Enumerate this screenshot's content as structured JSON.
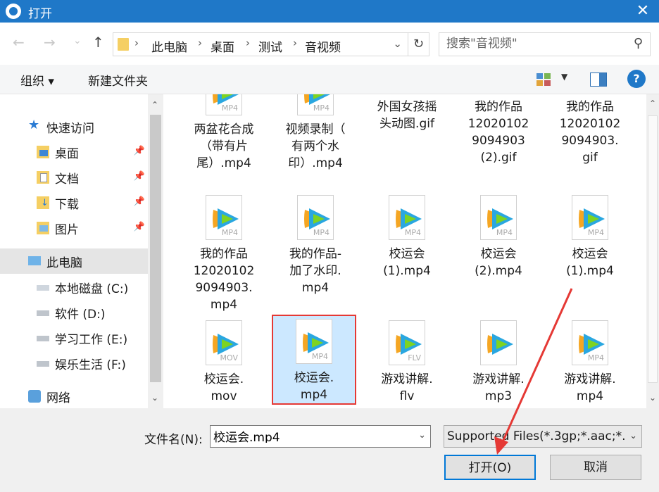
{
  "window": {
    "title": "打开",
    "close_glyph": "✕"
  },
  "nav": {
    "back": "←",
    "forward": "→",
    "history": "⌄",
    "up": "↑",
    "breadcrumbs": [
      "此电脑",
      "桌面",
      "测试",
      "音视频"
    ],
    "refresh_glyph": "↻"
  },
  "search": {
    "placeholder": "搜索\"音视频\""
  },
  "toolbar": {
    "organize": "组织 ▾",
    "new_folder": "新建文件夹",
    "help": "?"
  },
  "sidebar": {
    "quick_access": "快速访问",
    "items": [
      {
        "label": "桌面",
        "icon": "desktop-folder-icon"
      },
      {
        "label": "文档",
        "icon": "documents-folder-icon"
      },
      {
        "label": "下载",
        "icon": "downloads-folder-icon"
      },
      {
        "label": "图片",
        "icon": "pictures-folder-icon"
      }
    ],
    "this_pc": "此电脑",
    "drives": [
      {
        "label": "本地磁盘 (C:)"
      },
      {
        "label": "软件 (D:)"
      },
      {
        "label": "学习工作 (E:)"
      },
      {
        "label": "娱乐生活 (F:)"
      }
    ],
    "network": "网络"
  },
  "files": {
    "row1": [
      {
        "lines": [
          "两盆花合成",
          "（带有片",
          "尾）.mp4"
        ],
        "ext": "MP4",
        "kind": "video"
      },
      {
        "lines": [
          "视频录制（",
          "有两个水",
          "印）.mp4"
        ],
        "ext": "MP4",
        "kind": "video"
      },
      {
        "lines": [
          "外国女孩摇",
          "头动图.gif"
        ],
        "ext": "",
        "kind": "gif"
      },
      {
        "lines": [
          "我的作品",
          "12020102",
          "9094903",
          "(2).gif"
        ],
        "ext": "",
        "kind": "photo"
      },
      {
        "lines": [
          "我的作品",
          "12020102",
          "9094903.",
          "gif"
        ],
        "ext": "",
        "kind": "photo"
      }
    ],
    "row2": [
      {
        "lines": [
          "我的作品",
          "12020102",
          "9094903.",
          "mp4"
        ],
        "ext": "MP4",
        "kind": "video"
      },
      {
        "lines": [
          "我的作品-",
          "加了水印.",
          "mp4"
        ],
        "ext": "MP4",
        "kind": "video"
      },
      {
        "lines": [
          "校运会",
          "(1).mp4"
        ],
        "ext": "MP4",
        "kind": "video"
      },
      {
        "lines": [
          "校运会",
          "(2).mp4"
        ],
        "ext": "MP4",
        "kind": "video"
      },
      {
        "lines": [
          "校运会",
          "(1).mp4"
        ],
        "ext": "MP4",
        "kind": "video"
      }
    ],
    "row3": [
      {
        "lines": [
          "校运会.",
          "mov"
        ],
        "ext": "MOV",
        "kind": "video"
      },
      {
        "lines": [
          "校运会.",
          "mp4"
        ],
        "ext": "MP4",
        "kind": "video",
        "selected": true
      },
      {
        "lines": [
          "游戏讲解.",
          "flv"
        ],
        "ext": "FLV",
        "kind": "video"
      },
      {
        "lines": [
          "游戏讲解.",
          "mp3"
        ],
        "ext": "",
        "kind": "video"
      },
      {
        "lines": [
          "游戏讲解.",
          "mp4"
        ],
        "ext": "MP4",
        "kind": "video"
      }
    ]
  },
  "footer": {
    "filename_label": "文件名(N):",
    "filename_value": "校运会.mp4",
    "filetype_value": "Supported Files(*.3gp;*.aac;*.",
    "open_label": "打开(O)",
    "cancel_label": "取消"
  },
  "colors": {
    "accent": "#1f78c8",
    "selection": "#cce8ff",
    "highlight_red": "#e53935"
  }
}
